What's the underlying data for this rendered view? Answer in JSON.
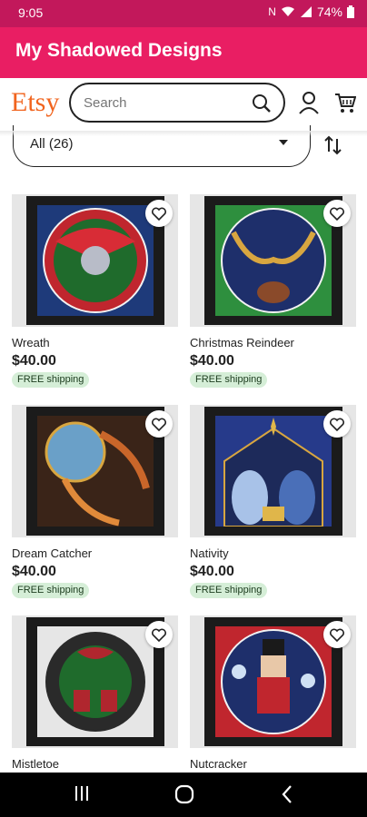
{
  "status": {
    "time": "9:05",
    "battery": "74%"
  },
  "appbar": {
    "title": "My Shadowed Designs"
  },
  "header": {
    "logo": "Etsy",
    "search_placeholder": "Search"
  },
  "filter": {
    "label": "All (26)"
  },
  "products": [
    {
      "name": "Wreath",
      "price": "$40.00",
      "shipping": "FREE shipping",
      "bg": "#c0262e",
      "accent": "#1f6b2c"
    },
    {
      "name": "Christmas Reindeer",
      "price": "$40.00",
      "shipping": "FREE shipping",
      "bg": "#2e8f3e",
      "accent": "#1e2f6b"
    },
    {
      "name": "Dream Catcher",
      "price": "$40.00",
      "shipping": "FREE shipping",
      "bg": "#3a2418",
      "accent": "#6aa0c8"
    },
    {
      "name": "Nativity",
      "price": "$40.00",
      "shipping": "FREE shipping",
      "bg": "#263a8a",
      "accent": "#e0b64a"
    },
    {
      "name": "Mistletoe",
      "price": "",
      "shipping": "",
      "bg": "#e6e6e6",
      "accent": "#b0262e"
    },
    {
      "name": "Nutcracker",
      "price": "",
      "shipping": "",
      "bg": "#c0262e",
      "accent": "#1e2f6b"
    }
  ],
  "colors": {
    "status_bar": "#c2185b",
    "app_bar": "#e91e63",
    "etsy_orange": "#f1641e",
    "free_ship_bg": "#d5eed7"
  }
}
